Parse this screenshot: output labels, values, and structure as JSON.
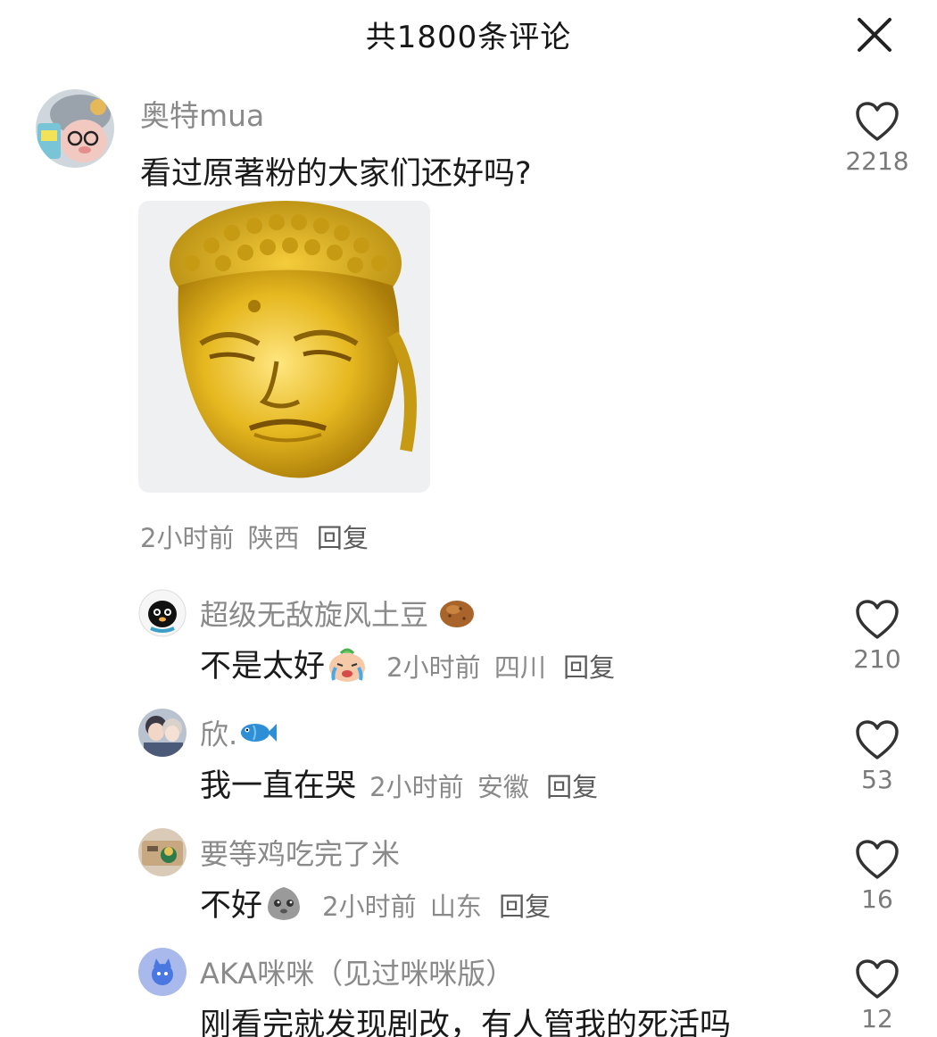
{
  "header": {
    "title": "共1800条评论",
    "close_icon": "close-icon"
  },
  "comments": [
    {
      "username": "奥特mua",
      "text": "看过原著粉的大家们还好吗?",
      "time": "2小时前",
      "location": "陕西",
      "reply_label": "回复",
      "likes": "2218",
      "has_image": true,
      "image_icon": "golden-buddha-sticker"
    }
  ],
  "replies": [
    {
      "username": "超级无敌旋风土豆",
      "username_emoji": "potato-emoji",
      "text": "不是太好",
      "text_emoji": "crying-face-emoji",
      "time": "2小时前",
      "location": "四川",
      "reply_label": "回复",
      "likes": "210"
    },
    {
      "username": "欣.",
      "username_emoji": "fish-emoji",
      "text": "我一直在哭",
      "time": "2小时前",
      "location": "安徽",
      "reply_label": "回复",
      "likes": "53"
    },
    {
      "username": "要等鸡吃完了米",
      "text": "不好",
      "text_emoji": "gray-blob-face-emoji",
      "time": "2小时前",
      "location": "山东",
      "reply_label": "回复",
      "likes": "16"
    },
    {
      "username": "AKA咪咪（见过咪咪版）",
      "text": "刚看完就发现剧改，有人管我的死活吗",
      "likes": "12"
    }
  ],
  "colors": {
    "text_primary": "#1a1a1a",
    "text_secondary": "#8a8a8a",
    "background": "#ffffff",
    "heart_stroke": "#333333"
  }
}
